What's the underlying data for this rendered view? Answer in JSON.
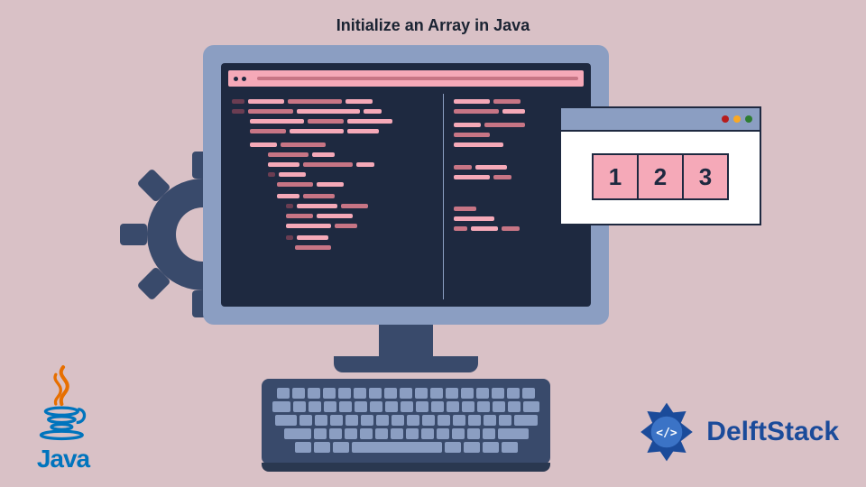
{
  "title": "Initialize an Array in Java",
  "array_cells": [
    "1",
    "2",
    "3"
  ],
  "window_dots": [
    "#b71c1c",
    "#f9a825",
    "#2e7d32"
  ],
  "logos": {
    "java": "Java",
    "delft": "DelftStack"
  },
  "colors": {
    "bg": "#d9c1c6",
    "monitor_frame": "#8b9ec2",
    "screen": "#1e2940",
    "accent_pink": "#f5a9b8",
    "keyboard": "#394a6b"
  }
}
